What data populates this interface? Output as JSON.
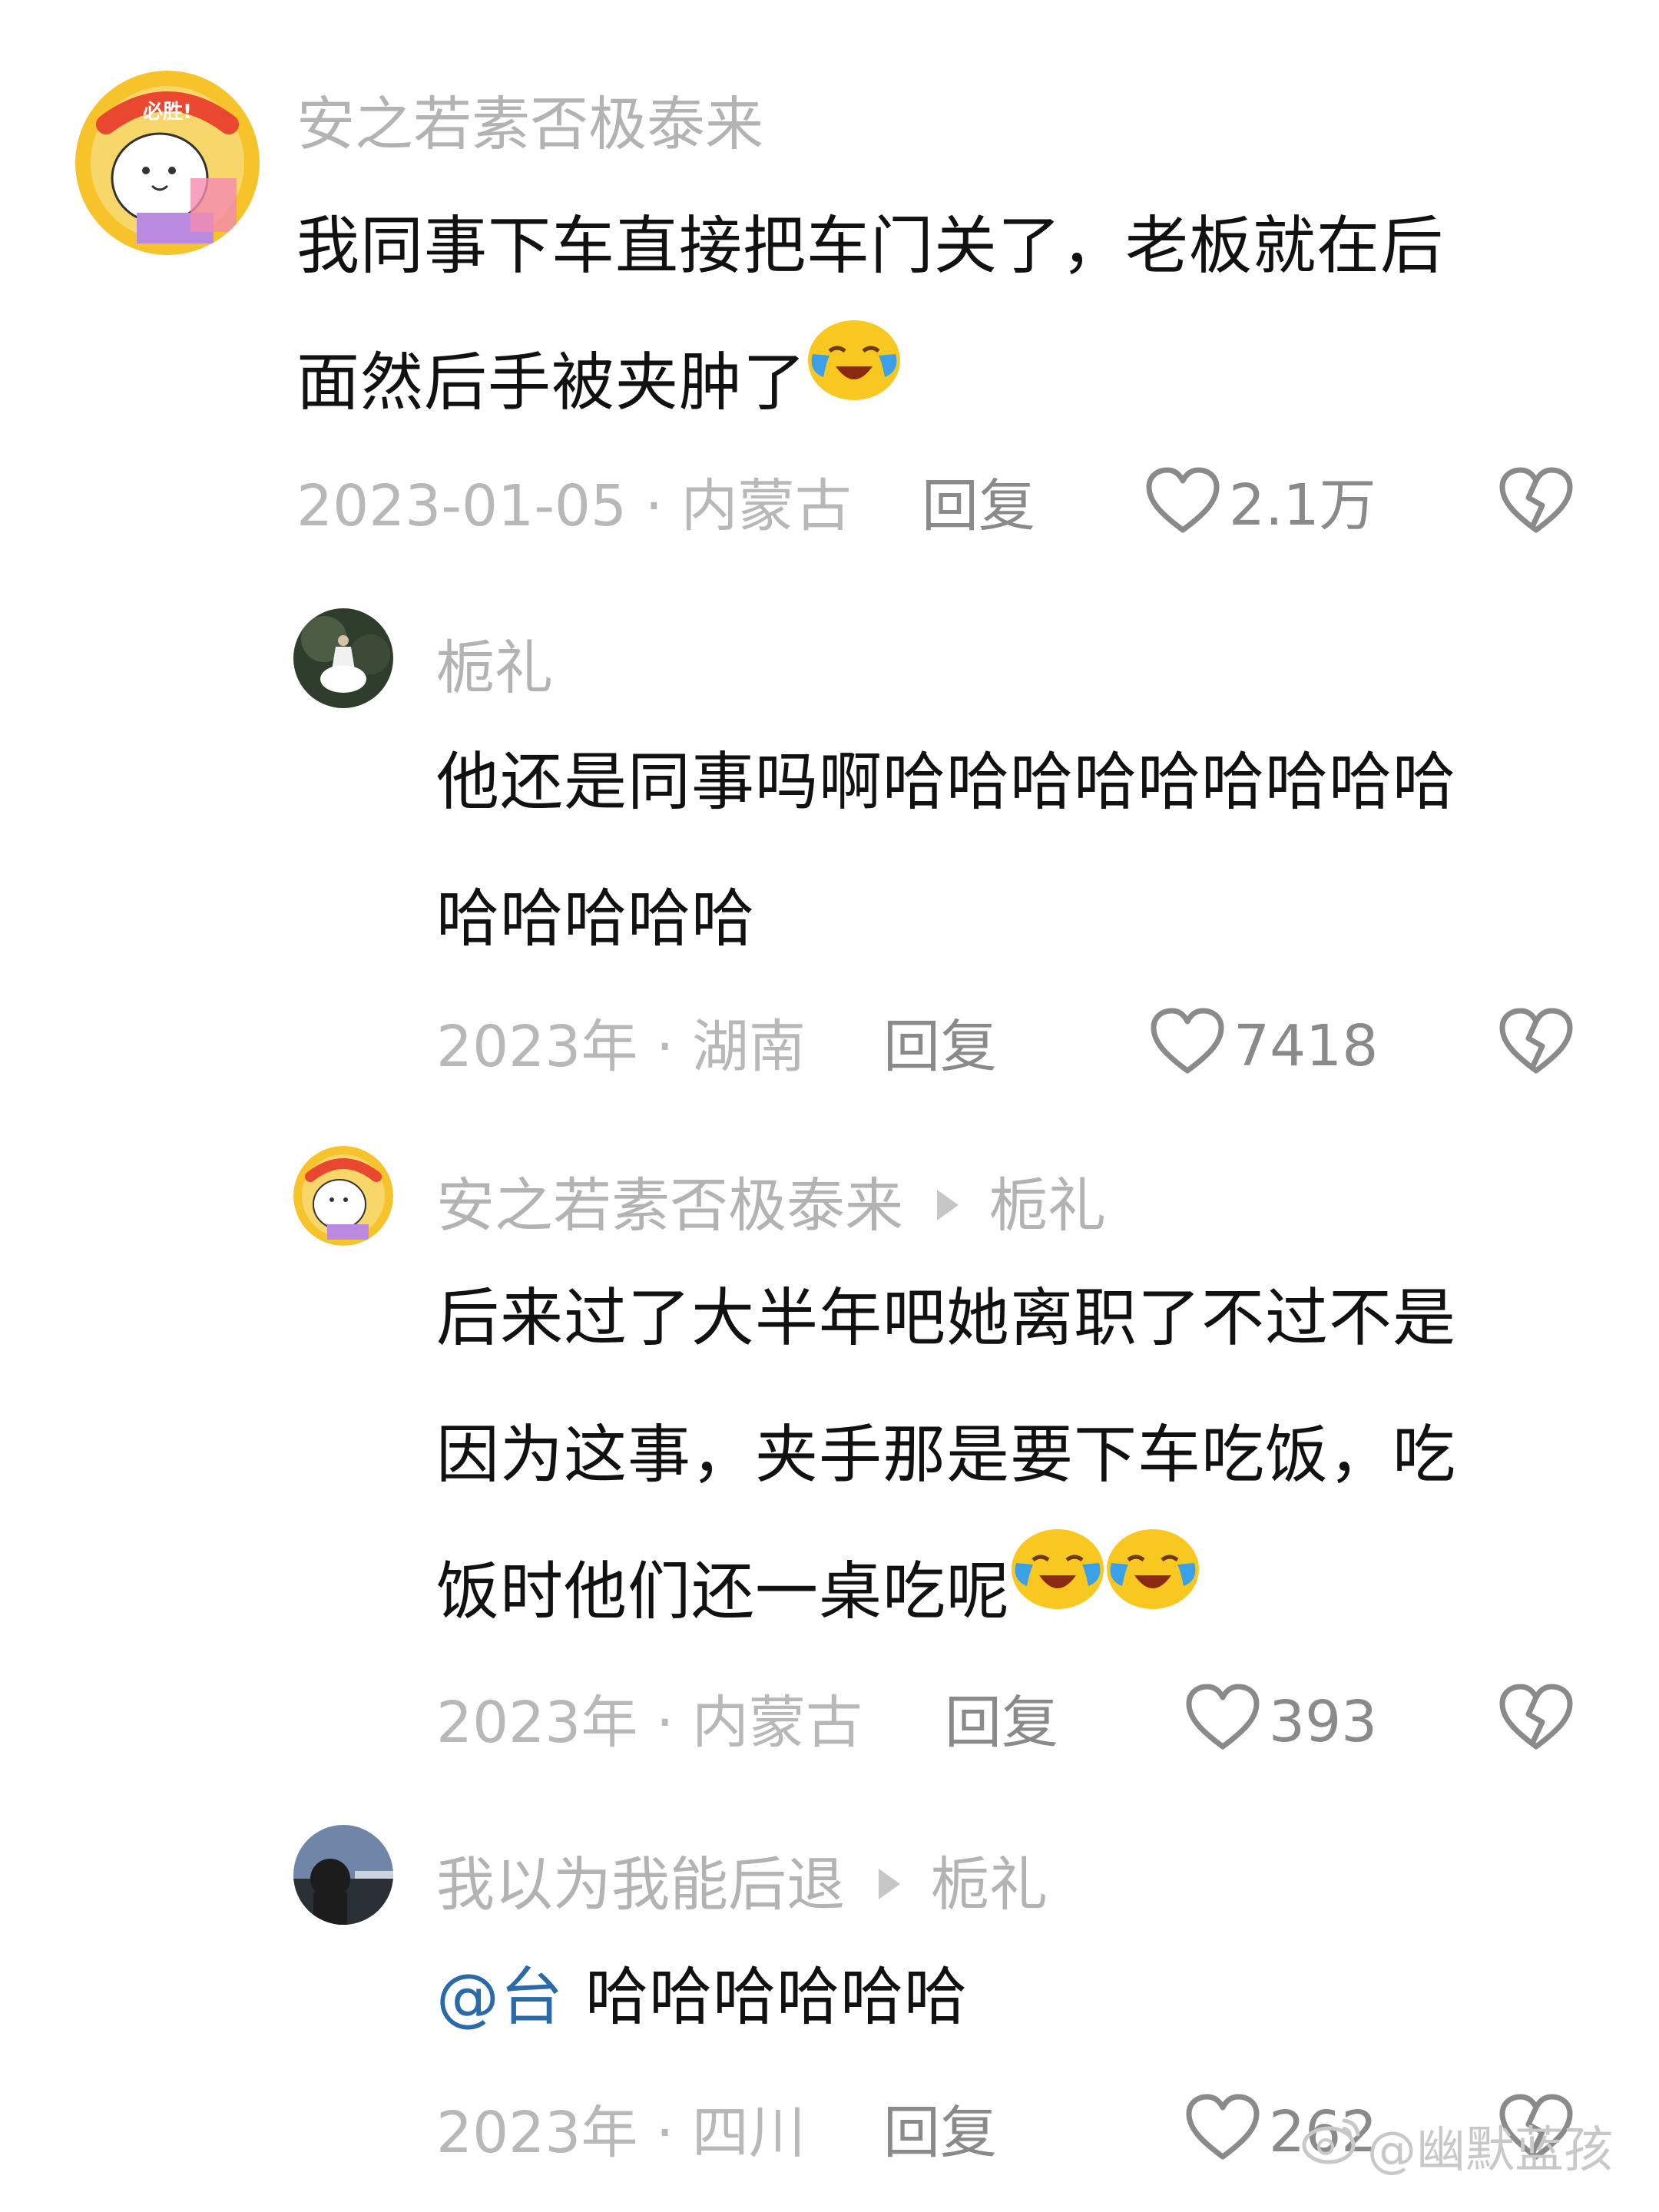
{
  "comments": [
    {
      "username": "安之若素否极泰来",
      "body": [
        "我同事下车直接把车门关了，老板就在后",
        "面然后手被夹肿了"
      ],
      "date_location": "2023-01-05 · 内蒙古",
      "reply_label": "回复",
      "likes": "2.1万"
    },
    {
      "username": "栀礼",
      "body": [
        "他还是同事吗啊哈哈哈哈哈哈哈哈哈",
        "哈哈哈哈哈"
      ],
      "date_location": "2023年 · 湖南",
      "reply_label": "回复",
      "likes": "7418"
    },
    {
      "username": "安之若素否极泰来",
      "reply_to": "栀礼",
      "body": [
        "后来过了大半年吧她离职了不过不是",
        "因为这事，夹手那是要下车吃饭，吃",
        "饭时他们还一桌吃呢"
      ],
      "date_location": "2023年 · 内蒙古",
      "reply_label": "回复",
      "likes": "393"
    },
    {
      "username": "我以为我能后退",
      "reply_to": "栀礼",
      "mention": "@台",
      "body": [
        "哈哈哈哈哈哈"
      ],
      "date_location": "2023年 · 四川",
      "reply_label": "回复",
      "likes": "262"
    }
  ],
  "avatar_badge_text": "必胜!",
  "watermark": {
    "text": "@幽默蓝孩",
    "icon": "weibo-icon"
  },
  "icons": {
    "like": "heart-outline-icon",
    "dislike": "broken-heart-icon",
    "emoji": "crying-laughing-emoji-icon"
  },
  "colors": {
    "username": "#b3b3b3",
    "body": "#111111",
    "meta": "#b8b8b8",
    "action": "#8a8a8a",
    "mention": "#2a6aa8"
  }
}
